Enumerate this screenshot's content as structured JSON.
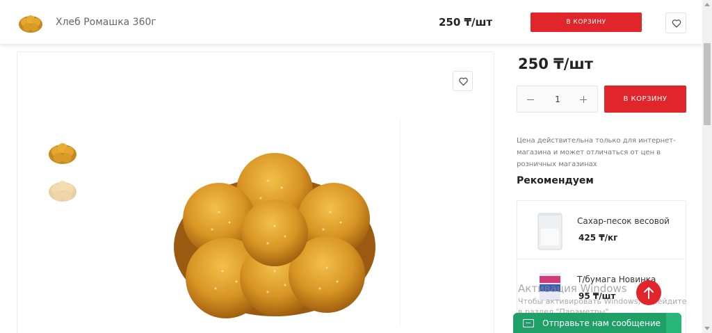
{
  "sticky_header": {
    "product_name": "Хлеб Ромашка 360г",
    "price": "250 ₸/шт",
    "cart_label": "В КОРЗИНУ"
  },
  "product": {
    "price": "250 ₸/шт",
    "quantity": "1",
    "cart_label": "В КОРЗИНУ",
    "price_note": "Цена действительна только для интернет-магазина и может отличаться от цен в розничных магазинах"
  },
  "recommend": {
    "title": "Рекомендуем",
    "items": [
      {
        "name": "Сахар-песок весовой",
        "price": "425 ₸/кг"
      },
      {
        "name": "Т/бумага Новинка",
        "price": "95 ₸/шт"
      }
    ]
  },
  "watermark": {
    "title": "Активация Windows",
    "subtitle": "Чтобы активировать Windows, перейдите в раздел \"Параметры\"."
  },
  "message_bar": {
    "label": "Отправьте нам сообщение"
  },
  "colors": {
    "accent": "#e0262b",
    "message": "#1fa068"
  }
}
